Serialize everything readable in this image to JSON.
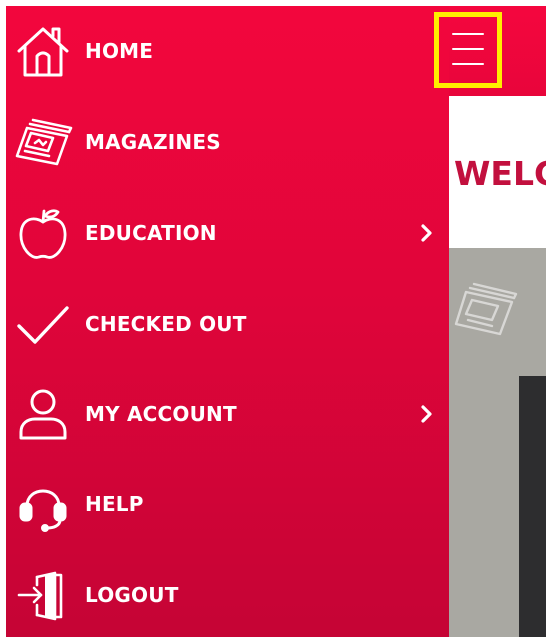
{
  "menu": {
    "items": [
      {
        "label": "HOME",
        "icon": "home-icon",
        "has_submenu": false
      },
      {
        "label": "MAGAZINES",
        "icon": "magazine-icon",
        "has_submenu": false
      },
      {
        "label": "EDUCATION",
        "icon": "apple-icon",
        "has_submenu": true
      },
      {
        "label": "CHECKED OUT",
        "icon": "checkmark-icon",
        "has_submenu": false
      },
      {
        "label": "MY ACCOUNT",
        "icon": "user-icon",
        "has_submenu": true
      },
      {
        "label": "HELP",
        "icon": "headset-icon",
        "has_submenu": false
      },
      {
        "label": "LOGOUT",
        "icon": "logout-door-icon",
        "has_submenu": false
      }
    ]
  },
  "main": {
    "welcome_text": "WELC"
  },
  "colors": {
    "sidebar_top": "#f3063d",
    "sidebar_bottom": "#c50435",
    "highlight_border": "#ffef00",
    "welcome_text": "#c2103e",
    "content_gray": "#a9a8a2",
    "dark_panel": "#2d2d2f"
  }
}
